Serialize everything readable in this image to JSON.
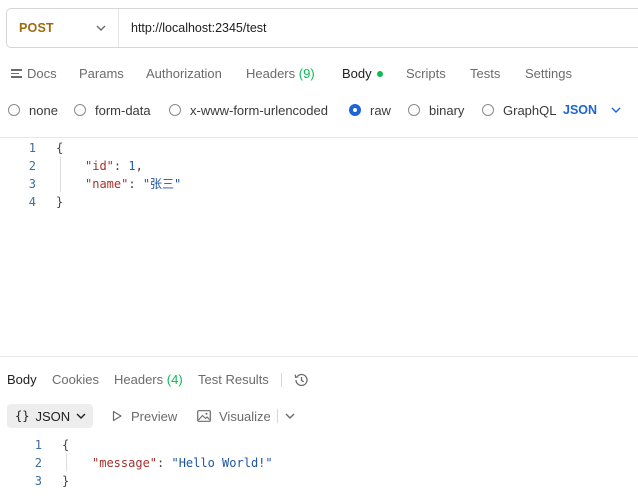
{
  "request": {
    "method": "POST",
    "url": "http://localhost:2345/test"
  },
  "request_tabs": {
    "docs": "Docs",
    "params": "Params",
    "authorization": "Authorization",
    "headers": "Headers",
    "headers_count": "(9)",
    "body": "Body",
    "scripts": "Scripts",
    "tests": "Tests",
    "settings": "Settings"
  },
  "body_types": {
    "none": "none",
    "form_data": "form-data",
    "urlencoded": "x-www-form-urlencoded",
    "raw": "raw",
    "binary": "binary",
    "graphql": "GraphQL",
    "selected": "raw",
    "format": "JSON"
  },
  "request_body": {
    "line_numbers": [
      "1",
      "2",
      "3",
      "4"
    ],
    "open_brace": "{",
    "close_brace": "}",
    "id_key": "\"id\"",
    "id_value": "1",
    "name_key": "\"name\"",
    "name_value": "\"张三\""
  },
  "response_tabs": {
    "body": "Body",
    "cookies": "Cookies",
    "headers": "Headers",
    "headers_count": "(4)",
    "test_results": "Test Results"
  },
  "response_toolbar": {
    "format": "JSON",
    "format_braces": "{}",
    "preview": "Preview",
    "visualize": "Visualize"
  },
  "response_body": {
    "line_numbers": [
      "1",
      "2",
      "3"
    ],
    "open_brace": "{",
    "close_brace": "}",
    "message_key": "\"message\"",
    "message_value": "\"Hello World!\""
  },
  "colors": {
    "accent": "#1c64d8",
    "method": "#a06a0b",
    "status_green": "#0cbb52",
    "json_key": "#a4322b",
    "json_value": "#1d55a3"
  },
  "icons": [
    "chevron-down-icon",
    "docs-icon",
    "history-icon",
    "preview-play-icon",
    "visualize-image-icon"
  ]
}
